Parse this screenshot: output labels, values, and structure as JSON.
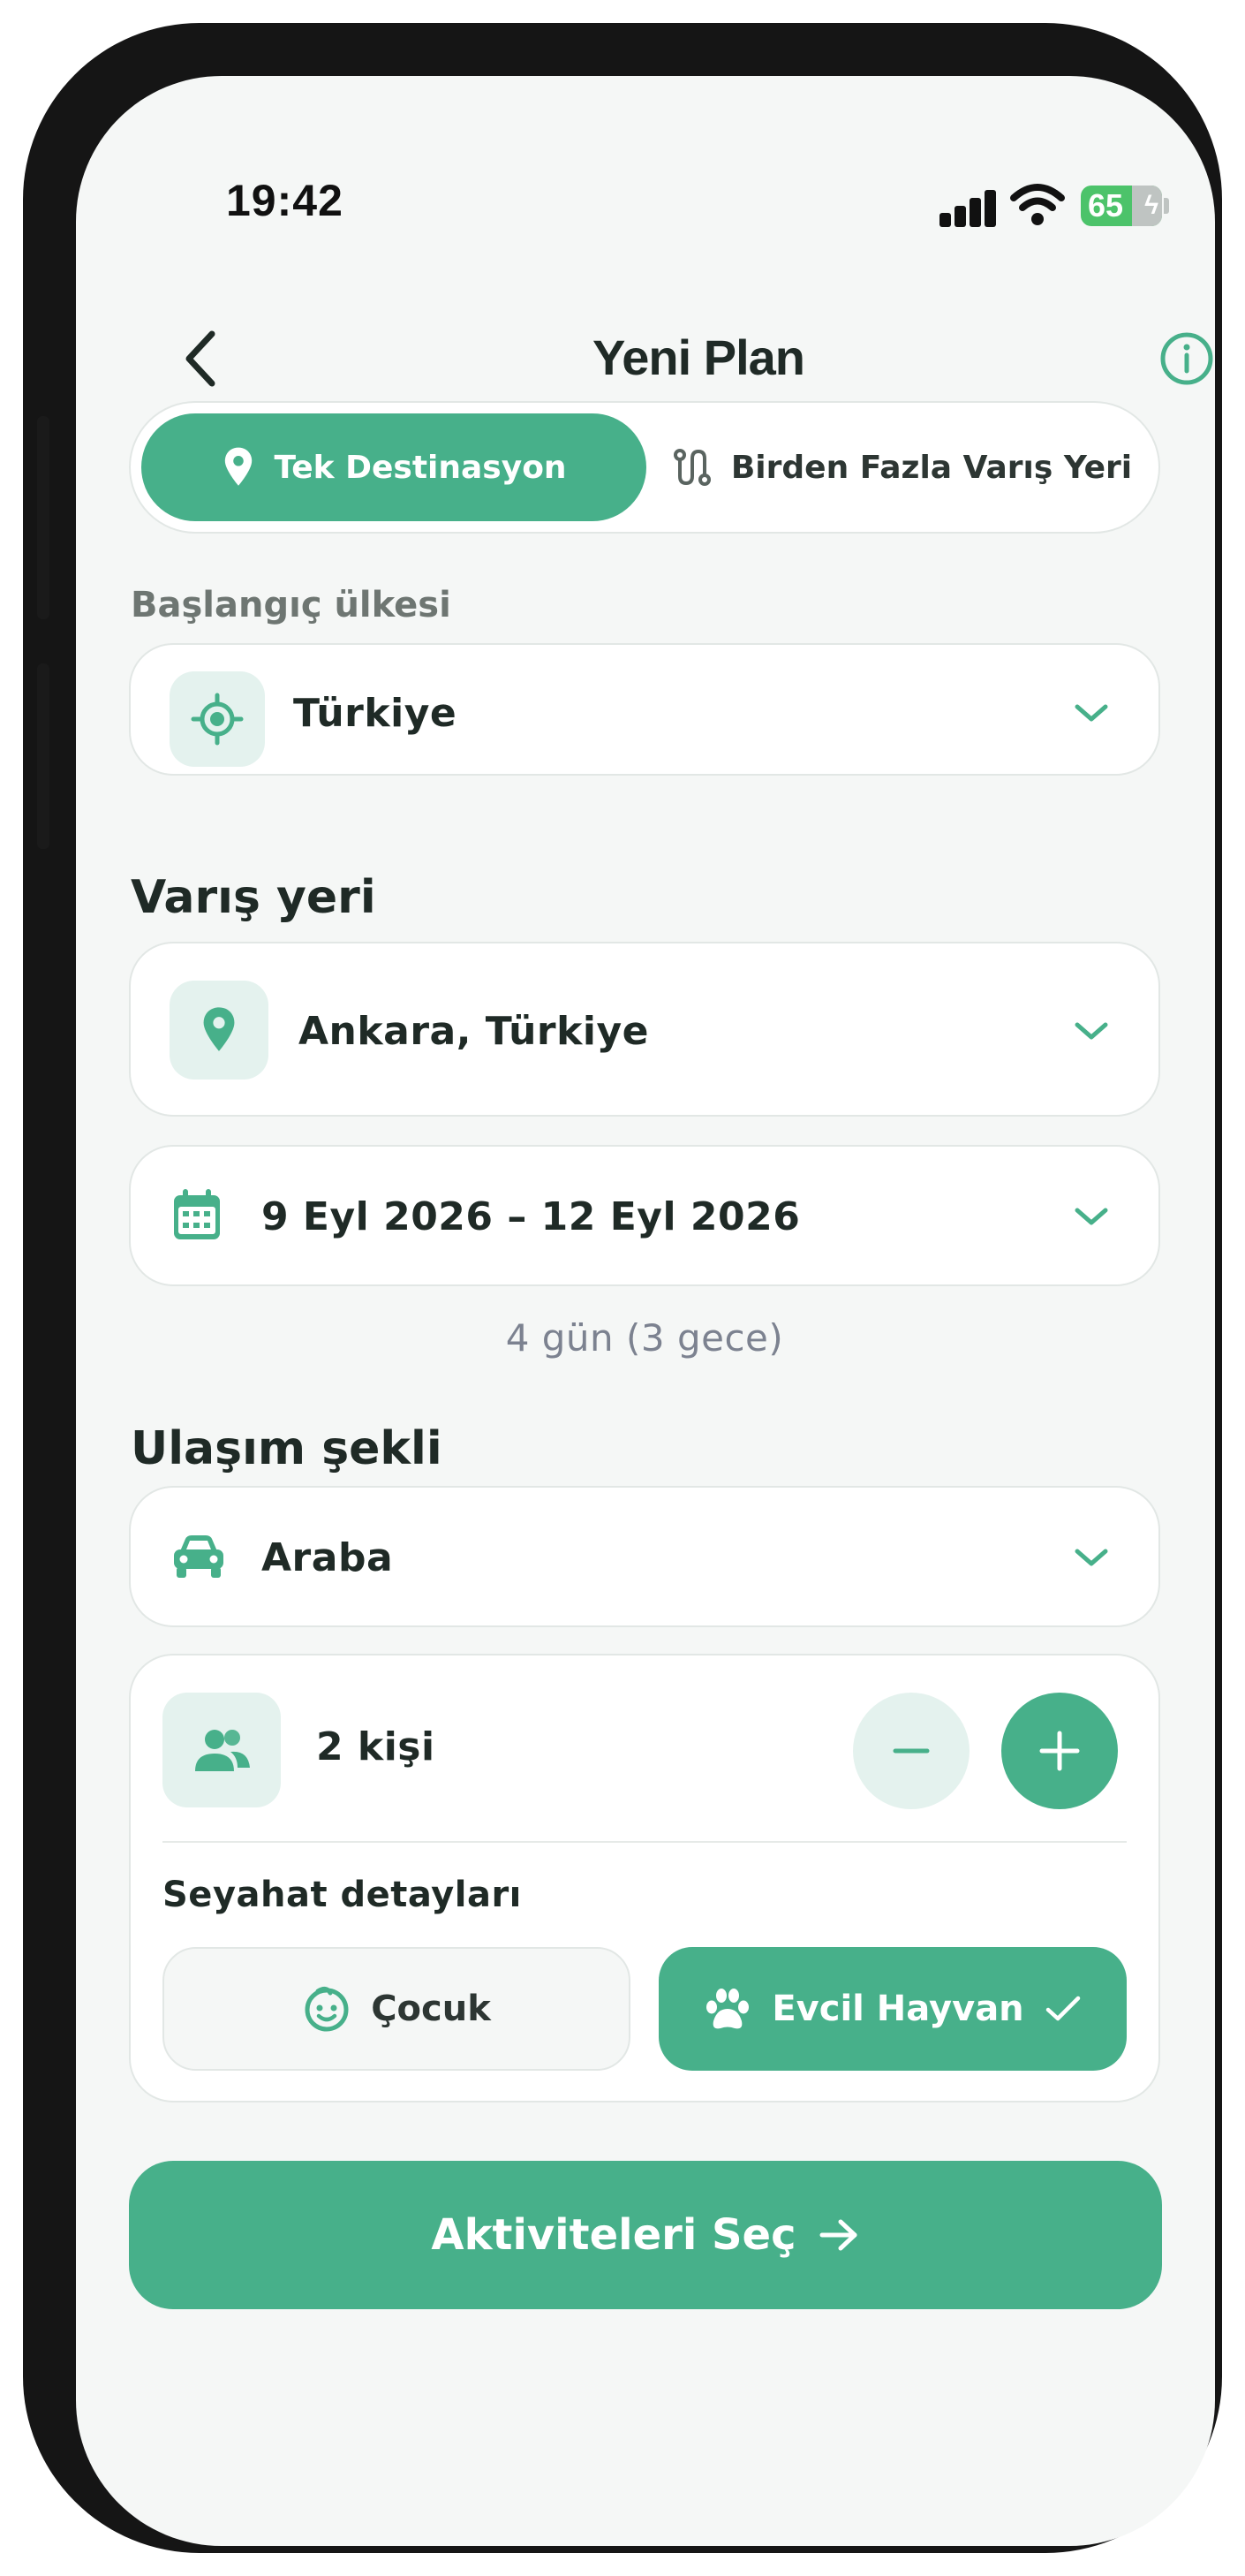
{
  "status_bar": {
    "time": "19:42",
    "battery": "65"
  },
  "header": {
    "title": "Yeni Plan"
  },
  "segment": {
    "options": [
      {
        "label": "Tek Destinasyon",
        "icon": "location-pin-icon",
        "active": true
      },
      {
        "label": "Birden Fazla Varış Yeri",
        "icon": "route-icon",
        "active": false
      }
    ]
  },
  "origin": {
    "label": "Başlangıç ülkesi",
    "value": "Türkiye",
    "icon": "target-icon"
  },
  "destination": {
    "label": "Varış yeri",
    "value": "Ankara, Türkiye",
    "icon": "location-pin-icon",
    "dates": "9 Eyl 2026 – 12 Eyl 2026",
    "date_icon": "calendar-icon",
    "duration": "4 gün (3 gece)"
  },
  "transport": {
    "label": "Ulaşım şekli",
    "value": "Araba",
    "icon": "car-icon"
  },
  "people": {
    "value": "2 kişi",
    "icon": "people-icon"
  },
  "details": {
    "label": "Seyahat detayları",
    "options": [
      {
        "label": "Çocuk",
        "icon": "child-face-icon",
        "selected": false
      },
      {
        "label": "Evcil Hayvan",
        "icon": "paw-icon",
        "selected": true
      }
    ]
  },
  "cta": {
    "label": "Aktiviteleri Seç"
  },
  "colors": {
    "accent": "#47b08a",
    "accent_light": "#e4f2ee",
    "background": "#f5f7f6",
    "text": "#1f2a26",
    "muted": "#7c8290"
  }
}
